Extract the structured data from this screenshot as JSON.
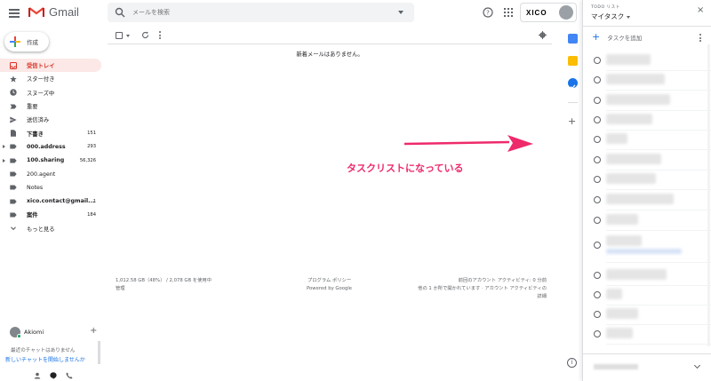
{
  "header": {
    "app_name": "Gmail",
    "search_placeholder": "メールを検索",
    "account_logo": "XICO"
  },
  "sidebar": {
    "compose_label": "作成",
    "items": [
      {
        "label": "受信トレイ",
        "icon": "inbox-icon",
        "count": "",
        "active": true,
        "bold": true
      },
      {
        "label": "スター付き",
        "icon": "star-icon",
        "count": ""
      },
      {
        "label": "スヌーズ中",
        "icon": "clock-icon",
        "count": ""
      },
      {
        "label": "重要",
        "icon": "important-icon",
        "count": ""
      },
      {
        "label": "送信済み",
        "icon": "send-icon",
        "count": ""
      },
      {
        "label": "下書き",
        "icon": "draft-icon",
        "count": "151",
        "bold": true
      },
      {
        "label": "000.address",
        "icon": "label-icon",
        "count": "293",
        "bold": true,
        "caret": true
      },
      {
        "label": "100.sharing",
        "icon": "label-icon",
        "count": "56,326",
        "bold": true,
        "caret": true
      },
      {
        "label": "200.agent",
        "icon": "label-icon",
        "count": ""
      },
      {
        "label": "Notes",
        "icon": "label-icon",
        "count": ""
      },
      {
        "label": "xico.contact@gmail...",
        "icon": "label-icon",
        "count": "1",
        "bold": true
      },
      {
        "label": "案件",
        "icon": "label-icon",
        "count": "184",
        "bold": true
      },
      {
        "label": "もっと見る",
        "icon": "chevron-down-icon",
        "count": ""
      }
    ]
  },
  "hangouts": {
    "user_name": "Akiomi",
    "no_chats": "最近のチャットはありません",
    "start_chat": "新しいチャットを開始しませんか"
  },
  "main": {
    "empty_message": "新着メールはありません。",
    "annotation": "タスクリストになっている",
    "annotation_color": "#ee2a6b",
    "footer_storage": "1,012.58 GB（48%） / 2,078 GB を使用中",
    "footer_manage": "管理",
    "footer_policy": "プログラム ポリシー",
    "footer_powered": "Powered by Google",
    "footer_activity1": "前回のアカウント アクティビティ: 0 分前",
    "footer_activity2": "他の 1 か所で開かれています · アカウント アクティビティの",
    "footer_details": "詳細"
  },
  "tasks": {
    "subtitle": "TODO リスト",
    "title": "マイタスク",
    "add_label": "タスクを追加"
  },
  "colors": {
    "accent_red": "#d93025",
    "accent_blue": "#1a73e8",
    "active_bg": "#fce8e6"
  }
}
